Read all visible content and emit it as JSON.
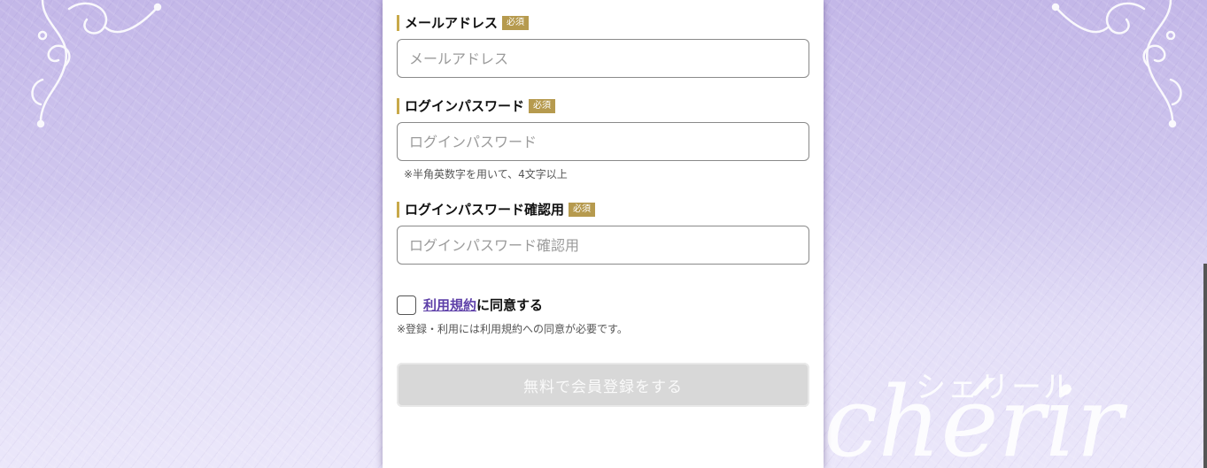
{
  "form": {
    "email": {
      "label": "メールアドレス",
      "required_badge": "必須",
      "placeholder": "メールアドレス"
    },
    "password": {
      "label": "ログインパスワード",
      "required_badge": "必須",
      "placeholder": "ログインパスワード",
      "hint": "※半角英数字を用いて、4文字以上"
    },
    "password_confirm": {
      "label": "ログインパスワード確認用",
      "required_badge": "必須",
      "placeholder": "ログインパスワード確認用"
    },
    "agreement": {
      "checked": false,
      "terms_link": "利用規約",
      "suffix": "に同意する",
      "note": "※登録・利用には利用規約への同意が必要です。"
    },
    "submit_label": "無料で会員登録をする"
  },
  "brand": {
    "kana": "シェリール",
    "script": "chérir"
  },
  "colors": {
    "background": "#c9bfeb",
    "badge": "#b69a4e",
    "label_bar": "#c8a94a",
    "link": "#5d3fa8",
    "submit_disabled": "#d8d8d8"
  },
  "icons": [
    "flourish-ornament-left",
    "flourish-ornament-right"
  ]
}
